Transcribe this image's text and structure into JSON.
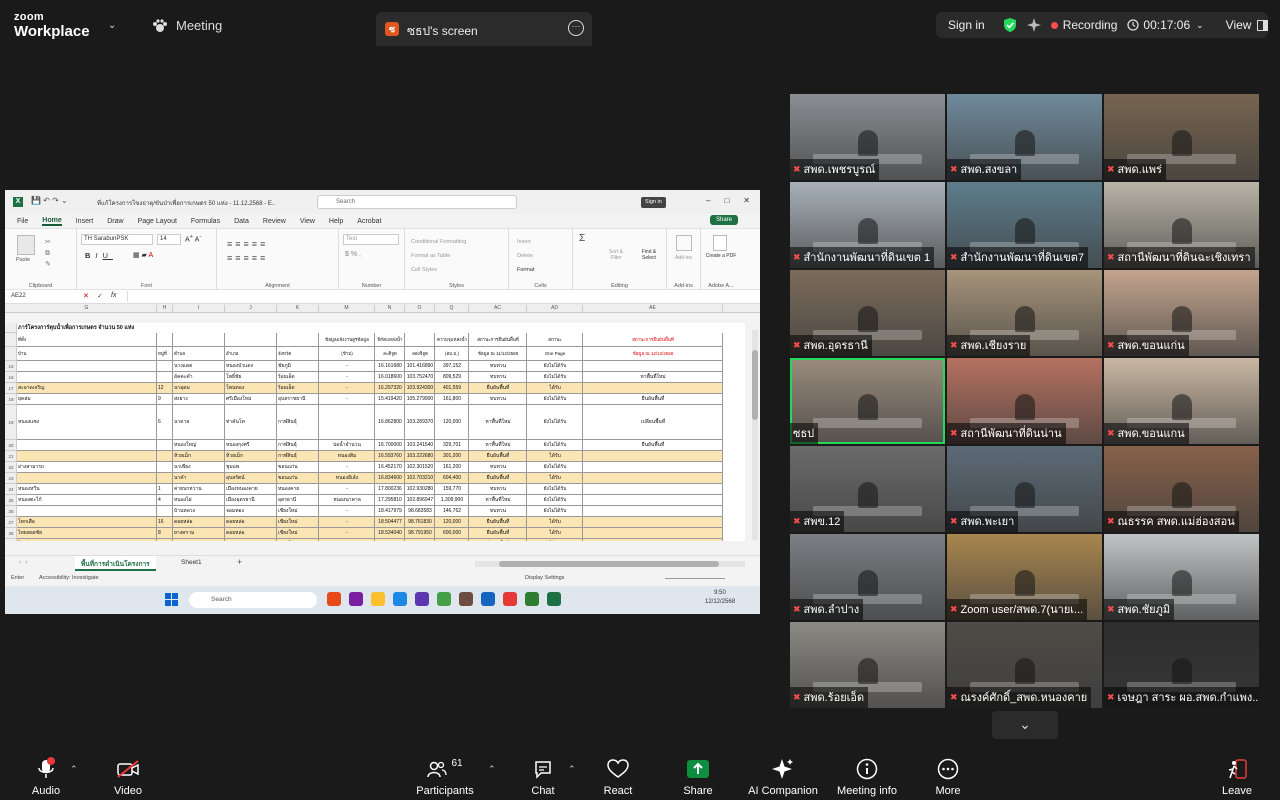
{
  "topbar": {
    "logo_line1": "zoom",
    "logo_line2": "Workplace",
    "meeting_tab": "Meeting",
    "share_tab_label": "ซธป's screen",
    "share_tab_initial": "ซ",
    "sign_in": "Sign in",
    "recording": "Recording",
    "timer": "00:17:06",
    "view": "View"
  },
  "excel": {
    "title": "ที่แก้โครงการโขงธาตุ/ขันป่าเพื่อการเกษตร 50 แห่ง - 11.12.2568 - E..",
    "search": "Search",
    "sign_in": "Sign in",
    "menu": [
      "File",
      "Home",
      "Insert",
      "Draw",
      "Page Layout",
      "Formulas",
      "Data",
      "Review",
      "View",
      "Help",
      "Acrobat"
    ],
    "share": "Share",
    "font_name": "TH SarabunPSK",
    "font_size": "14",
    "cell_ref": "AE22",
    "ribbon_groups": [
      "Clipboard",
      "Font",
      "Alignment",
      "Number",
      "Styles",
      "Cells",
      "Editing",
      "Add-ins",
      "Adobe A..."
    ],
    "ribbon_labels": {
      "paste": "Paste",
      "number_format": "Text",
      "cond_format": "Conditional Formatting",
      "format_table": "Format as Table",
      "cell_styles": "Cell Styles",
      "insert": "Insert",
      "delete": "Delete",
      "format": "Format",
      "sort": "Sort & Filter",
      "find": "Find & Select",
      "addins": "Add-ins",
      "pdf": "Create a PDF"
    },
    "col_headers": [
      "G",
      "H",
      "I",
      "J",
      "K",
      "M",
      "N",
      "O",
      "Q",
      "AC",
      "AD",
      "AE"
    ],
    "sheet_title": "ภาร์โครงการ์ตุบน้ำเพื่อการเกษตร จำนวน 50 แห่ง",
    "header1": [
      "ที่ตั้ง",
      "",
      "",
      "",
      "",
      "ข้อมูลแจ้งงานสูรข้อมูล",
      "พิกัดแหล่งน้ำ",
      "",
      "ความจุแหล่งน้ำ",
      "สถานะการยืนยันพื้นที่",
      "สถานะ",
      "สถานะการยืนยันพื้นที่"
    ],
    "header2": [
      "บ้าน",
      "หมู่ที่",
      "ตำบล",
      "อำเภอ",
      "จังหวัด",
      "(ข้าม)",
      "ละติจูด",
      "ลองจิจูด",
      "(ลบ.ม.)",
      "ข้อมูล ณ 11/12/2568",
      "One Page",
      "ข้อมูล ณ 12/12/2568"
    ],
    "rows": [
      {
        "n": "15",
        "c": [
          "",
          "",
          "นางแดด",
          "หนองบัวแดง",
          "ชัยภูมิ",
          "-",
          "16.161680",
          "101.416890",
          "397,152",
          "ทบทวน",
          "ยังไม่ได้รับ",
          ""
        ],
        "hl": false
      },
      {
        "n": "16",
        "c": [
          "",
          "",
          "อัคคะคำ",
          "โพธิ์ชัย",
          "ร้อยเอ็ด",
          "-",
          "16.018600",
          "103.752470",
          "809,529",
          "ทบทวน",
          "ยังไม่ได้รับ",
          "หาพื้นที่ใหม่"
        ],
        "hl": false
      },
      {
        "n": "17",
        "c": [
          "สะอาดเจริญ",
          "12",
          "นาอุดม",
          "โพนทอง",
          "ร้อยเอ็ด",
          "-",
          "16.297320",
          "103.924300",
          "401,559",
          "ยืนยันพื้นที่",
          "ได้รับ",
          ""
        ],
        "hl": true
      },
      {
        "n": "18",
        "c": [
          "ยุคล่ม",
          "9",
          "ส่งยาง",
          "ศรีเมืองใหม่",
          "อุบลราชธานี",
          "-",
          "15.419420",
          "105.279900",
          "161,800",
          "ทบทวน",
          "ยังไม่ได้รับ",
          "ยืนยันพื้นที่"
        ],
        "hl": false
      },
      {
        "n": "19",
        "c": [
          "หนองแซง",
          "6",
          "นาดาล",
          "ท่าคันโท",
          "กาฬสินธุ์",
          "",
          "16.862800",
          "103.289370",
          "120,000",
          "หาพื้นที่ใหม่",
          "ยังไม่ได้รับ",
          "เปลี่ยนพื้นที่"
        ],
        "hl": false,
        "tall": true
      },
      {
        "n": "20",
        "c": [
          "",
          "",
          "หนองใหญ่",
          "หนองกุงศรี",
          "กาฬสินธุ์",
          "บ่อน้ำจำนวน",
          "16.700000",
          "103.241540",
          "329,701",
          "หาพื้นที่ใหม่",
          "ยังไม่ได้รับ",
          "ยืนยันพื้นที่"
        ],
        "hl": false
      },
      {
        "n": "21",
        "c": [
          "",
          "",
          "ห้วยเม็ก",
          "ห้วยเม็ก",
          "กาฬสินธุ์",
          "หนองสิม",
          "16.593760",
          "103.222680",
          "301,200",
          "ยืนยันพื้นที่",
          "ได้รับ",
          ""
        ],
        "hl": true
      },
      {
        "n": "22",
        "c": [
          "อ่างสามารถ",
          "",
          "นาเพียง",
          "ชุมแพ",
          "ขอนแก่น",
          "-",
          "16.452170",
          "102.301520",
          "161,200",
          "ทบทวน",
          "ยังไม่ได้รับ",
          ""
        ],
        "hl": false
      },
      {
        "n": "23",
        "c": [
          "",
          "",
          "นาคำ",
          "อุบลรัตน์",
          "ขอนแก่น",
          "หนองอีเล้ง",
          "16.834600",
          "102.703210",
          "604,400",
          "ยืนยันพื้นที่",
          "ได้รับ",
          ""
        ],
        "hl": true
      },
      {
        "n": "24",
        "c": [
          "หนองหวีน",
          "1",
          "ค่ายบกหวาน",
          "เมืองหนองคาย",
          "หนองคาย",
          "-",
          "17.800236",
          "102.930280",
          "159,770",
          "ทบทวน",
          "ยังไม่ได้รับ",
          ""
        ],
        "hl": false
      },
      {
        "n": "25",
        "c": [
          "หนองตะไก้",
          "4",
          "หนองไผ่",
          "เมืองอุดรธานี",
          "อุดรธานี",
          "หนองนาคาล",
          "17.295810",
          "102.896947",
          "1,309,900",
          "หาพื้นที่ใหม่",
          "ยังไม่ได้รับ",
          ""
        ],
        "hl": false
      },
      {
        "n": "26",
        "c": [
          "",
          "",
          "บ้านหลวง",
          "จอมทอง",
          "เชียงใหม่",
          "-",
          "18.417979",
          "98.683583",
          "146,762",
          "ทบทวน",
          "ยังไม่ได้รับ",
          ""
        ],
        "hl": false
      },
      {
        "n": "27",
        "c": [
          "โทกเสือ",
          "16",
          "ดอยหล่อ",
          "ดอยหล่อ",
          "เชียงใหม่",
          "-",
          "18.504477",
          "98.761830",
          "120,000",
          "ยืนยันพื้นที่",
          "ได้รับ",
          ""
        ],
        "hl": true
      },
      {
        "n": "28",
        "c": [
          "ไทยสอยชัย",
          "8",
          "ยางคราม",
          "ดอยหล่อ",
          "เชียงใหม่",
          "-",
          "18.534040",
          "98.791950",
          "600,000",
          "ยืนยันพื้นที่",
          "ได้รับ",
          ""
        ],
        "hl": true
      },
      {
        "n": "29",
        "c": [
          "ไทยห้วยหลอด",
          "8",
          "สันติสุข",
          "ดอยหล่อ",
          "เชียงใหม่",
          "-",
          "18.524680",
          "98.780727",
          "324,899",
          "ยืนยันพื้นที่",
          "ได้รับ",
          ""
        ],
        "hl": true
      }
    ],
    "sheet_tabs": [
      "พื้นที่การดำเนินโครงการ",
      "Sheet1"
    ],
    "status_left": "Enter",
    "accessibility": "Accessibility: Investigate",
    "display_settings": "Display Settings",
    "taskbar_search": "Search",
    "clock_time": "9:50",
    "clock_date": "12/12/2568"
  },
  "gallery": [
    {
      "name": "สพด.เพชรบูรณ์",
      "bg": "#8a8f93"
    },
    {
      "name": "สพด.สงขลา",
      "bg": "#6f8a9b"
    },
    {
      "name": "สพด.แพร่",
      "bg": "#76644f"
    },
    {
      "name": "สำนักงานพัฒนาที่ดินเขต 1",
      "bg": "#a8b0b8"
    },
    {
      "name": "สำนักงานพัฒนาที่ดินเขต7",
      "bg": "#5d7d8c"
    },
    {
      "name": "สถานีพัฒนาที่ดินฉะเชิงเทรา",
      "bg": "#b9b4a7"
    },
    {
      "name": "สพด.อุดรธานี",
      "bg": "#7a6b5a"
    },
    {
      "name": "สพด.เชียงราย",
      "bg": "#a7947b"
    },
    {
      "name": "สพด.ขอนแก่น",
      "bg": "#c3a48e"
    },
    {
      "name": "ซธป",
      "bg": "#9a8b7d",
      "active": true,
      "muted": false
    },
    {
      "name": "สถานีพัฒนาที่ดินน่าน",
      "bg": "#b5715f"
    },
    {
      "name": "สพด.ขอนแกน",
      "bg": "#c9b7a3"
    },
    {
      "name": "สพข.12",
      "bg": "#6b6b6b"
    },
    {
      "name": "สพด.พะเยา",
      "bg": "#5c6a76"
    },
    {
      "name": "ณธรรค สพด.แม่ฮ่องสอน",
      "bg": "#87614a"
    },
    {
      "name": "สพด.ลำปาง",
      "bg": "#7b7f83"
    },
    {
      "name": "Zoom user/สพด.7(นายเ...",
      "bg": "#a8864f"
    },
    {
      "name": "สพด.ชัยภูมิ",
      "bg": "#c1c4c6"
    },
    {
      "name": "สพด.ร้อยเอ็ด",
      "bg": "#8c8a84"
    },
    {
      "name": "ณรงค์ศักดิ์_สพด.หนองคาย",
      "bg": "#4f4b46"
    },
    {
      "name": "เจษฎา สาระ ผอ.สพด.กำแพง...",
      "bg": "#2e2e2e"
    }
  ],
  "toolbar": {
    "audio": "Audio",
    "video": "Video",
    "participants": "Participants",
    "participants_count": "61",
    "chat": "Chat",
    "react": "React",
    "share": "Share",
    "ai_companion": "AI Companion",
    "meeting_info": "Meeting info",
    "more": "More",
    "leave": "Leave"
  },
  "colors": {
    "accent_green": "#23d959",
    "record_red": "#ff4d4d",
    "share_green": "#0e8e3f",
    "excel_green": "#1e7145",
    "row_highlight": "#fbe5b4"
  }
}
